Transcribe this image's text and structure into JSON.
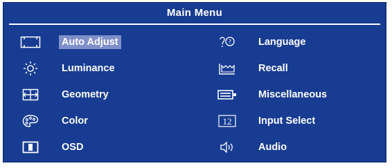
{
  "menu": {
    "title": "Main Menu",
    "left_items": [
      {
        "label": "Auto Adjust",
        "icon": "auto-adjust-icon",
        "selected": true
      },
      {
        "label": "Luminance",
        "icon": "sun-icon",
        "selected": false
      },
      {
        "label": "Geometry",
        "icon": "geometry-icon",
        "selected": false
      },
      {
        "label": "Color",
        "icon": "palette-icon",
        "selected": false
      },
      {
        "label": "OSD",
        "icon": "osd-window-icon",
        "selected": false
      }
    ],
    "right_items": [
      {
        "label": "Language",
        "icon": "language-icon",
        "selected": false
      },
      {
        "label": "Recall",
        "icon": "recall-icon",
        "selected": false
      },
      {
        "label": "Miscellaneous",
        "icon": "miscellaneous-icon",
        "selected": false
      },
      {
        "label": "Input Select",
        "icon": "input-select-icon",
        "icon_text": "12",
        "selected": false
      },
      {
        "label": "Audio",
        "icon": "speaker-icon",
        "selected": false
      }
    ]
  },
  "colors": {
    "background": "#173c92",
    "text": "#ffffff",
    "highlight": "#7f8fc9"
  }
}
